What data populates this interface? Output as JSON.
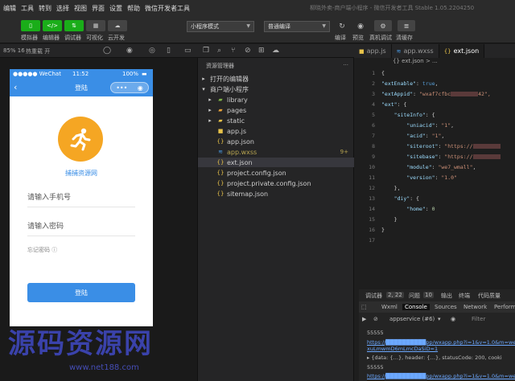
{
  "menubar": {
    "items": [
      "编辑",
      "工具",
      "转到",
      "选择",
      "视图",
      "界面",
      "设置",
      "帮助",
      "微信开发者工具"
    ],
    "window_title": "柳晓外卖-商户端小程序 - 微信开发者工具 Stable 1.05.2204250"
  },
  "toolbar": {
    "simulator_label": "模拟器",
    "editor_label": "编辑器",
    "debugger_label": "调试器",
    "visual_label": "可视化",
    "cloud_label": "云开发",
    "mode_select": "小程序模式",
    "compile_select": "普通编译",
    "compile_label": "编译",
    "preview_label": "预览",
    "remote_debug_label": "真机调试",
    "clear_cache_label": "清缓存"
  },
  "subbar": {
    "zoom": "85% 16",
    "hotreload": "热重载 开"
  },
  "simulator": {
    "carrier": "●●●●● WeChat",
    "time": "11:52",
    "battery": "100%",
    "nav_title": "登陆",
    "brand": "捕捕资源网",
    "phone_placeholder": "请输入手机号",
    "password_placeholder": "请输入密码",
    "forgot": "忘记密码 ⓘ",
    "login_button": "登陆"
  },
  "explorer": {
    "title": "资源管理器",
    "open_editors": "打开的编辑器",
    "project": "商户端小程序",
    "items": [
      {
        "name": "library",
        "type": "folder",
        "icon": "▸",
        "badge": ""
      },
      {
        "name": "pages",
        "type": "folder",
        "icon": "▸",
        "badge": ""
      },
      {
        "name": "static",
        "type": "folder",
        "icon": "▸",
        "badge": ""
      },
      {
        "name": "app.js",
        "type": "js",
        "icon": "JS",
        "badge": ""
      },
      {
        "name": "app.json",
        "type": "json",
        "icon": "{}",
        "badge": ""
      },
      {
        "name": "app.wxss",
        "type": "wxss",
        "icon": "≋",
        "badge": "9+"
      },
      {
        "name": "ext.json",
        "type": "json",
        "icon": "{}",
        "badge": ""
      },
      {
        "name": "project.config.json",
        "type": "json",
        "icon": "{}",
        "badge": ""
      },
      {
        "name": "project.private.config.json",
        "type": "json",
        "icon": "{}",
        "badge": ""
      },
      {
        "name": "sitemap.json",
        "type": "json",
        "icon": "{}",
        "badge": ""
      }
    ]
  },
  "editor": {
    "tabs": [
      "app.js",
      "app.wxss",
      "ext.json"
    ],
    "breadcrumb": "{} ext.json > ...",
    "line_numbers": [
      "1",
      "2",
      "3",
      "4",
      "5",
      "6",
      "7",
      "8",
      "9",
      "10",
      "11",
      "12",
      "13",
      "14",
      "15",
      "16",
      "17"
    ],
    "lines": [
      {
        "code": "{"
      },
      {
        "key": "\"extEnable\"",
        "val": "true",
        "vtype": "kw",
        "tail": ","
      },
      {
        "key": "\"extAppid\"",
        "val": "\"wxaf7cfbc",
        "vtype": "s",
        "redact": true,
        "tail2": "42\","
      },
      {
        "key": "\"ext\"",
        "tail": ": {"
      },
      {
        "indent": "    ",
        "key": "\"siteInfo\"",
        "tail": ": {"
      },
      {
        "indent": "        ",
        "key": "\"uniacid\"",
        "val": "\"1\"",
        "vtype": "s",
        "tail": ","
      },
      {
        "indent": "        ",
        "key": "\"acid\"",
        "val": "\"1\"",
        "vtype": "s",
        "tail": ","
      },
      {
        "indent": "        ",
        "key": "\"siteroot\"",
        "val": "\"https://",
        "vtype": "s",
        "redact": true
      },
      {
        "indent": "        ",
        "key": "\"sitebase\"",
        "val": "\"https://",
        "vtype": "s",
        "redact": true
      },
      {
        "indent": "        ",
        "key": "\"module\"",
        "val": "\"we7_wmall\"",
        "vtype": "s",
        "tail": ","
      },
      {
        "indent": "        ",
        "key": "\"version\"",
        "val": "\"1.0\"",
        "vtype": "s"
      },
      {
        "indent": "    ",
        "code": "},"
      },
      {
        "indent": "    ",
        "key": "\"diy\"",
        "tail": ": {"
      },
      {
        "indent": "        ",
        "key": "\"home\"",
        "val": "0",
        "vtype": "n"
      },
      {
        "indent": "    ",
        "code": "}"
      },
      {
        "code": "}"
      },
      {
        "code": ""
      }
    ]
  },
  "console": {
    "debugger_label": "调试器",
    "debugger_count": "2, 22",
    "problems_label": "问题",
    "problems_count": "10",
    "output_label": "输出",
    "terminal_label": "终端",
    "quality_label": "代码质量",
    "devtabs": [
      "Wxml",
      "Console",
      "Sources",
      "Network",
      "Perform"
    ],
    "context": "appservice (#6)",
    "filter_placeholder": "Filter",
    "logs": [
      {
        "text": "55555",
        "style": "gray"
      },
      {
        "text": "https://██████████pp/wxapp.php?i=1&v=1.0&m=we",
        "style": "blue"
      },
      {
        "text": "xuLmwmD6mLmcDaSiD=1",
        "style": "blue"
      },
      {
        "text": "▸ {data: {…}, header: {…}, statusCode: 200, cooki",
        "style": "gray"
      },
      {
        "text": "55555",
        "style": "gray"
      },
      {
        "text": "https://██████████pp/wxapp.php?i=1&v=1.0&m=we",
        "style": "blue"
      }
    ]
  },
  "watermark": {
    "main": "源码资源网",
    "url": "www.net188.com"
  }
}
